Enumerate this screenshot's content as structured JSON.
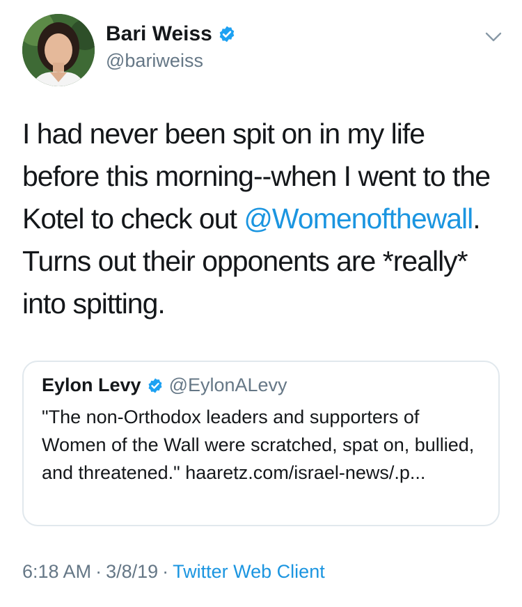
{
  "author": {
    "name": "Bari Weiss",
    "handle": "@bariweiss",
    "verified": true
  },
  "tweet": {
    "text_before_mention": "I had never been spit on in my life before this morning--when I went to the Kotel to check out ",
    "mention": "@Womenofthewall",
    "text_after_mention": ". Turns out their opponents are *really* into spitting."
  },
  "quoted_tweet": {
    "name": "Eylon Levy",
    "handle": "@EylonALevy",
    "verified": true,
    "text": "\"The non-Orthodox leaders and supporters of Women of the Wall were scratched, spat on, bullied, and threatened.\" haaretz.com/israel-news/.p..."
  },
  "meta": {
    "time": "6:18 AM",
    "separator": "·",
    "date": "3/8/19",
    "client": "Twitter Web Client"
  },
  "icons": {
    "verified": "verified-badge-icon",
    "menu": "chevron-down-icon"
  },
  "colors": {
    "link": "#1b95e0",
    "secondary_text": "#657786",
    "border": "#e1e8ed"
  }
}
